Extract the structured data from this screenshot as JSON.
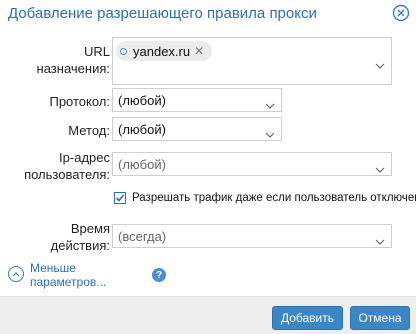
{
  "dialog": {
    "title": "Добавление разрешающего правила прокси"
  },
  "fields": {
    "url": {
      "label": "URL назначения:",
      "tags": [
        "yandex.ru"
      ]
    },
    "protocol": {
      "label": "Протокол:",
      "value": "(любой)"
    },
    "method": {
      "label": "Метод:",
      "value": "(любой)"
    },
    "user_ip": {
      "label": "Ip-адрес пользователя:",
      "placeholder": "(любой)"
    },
    "allow_when_disabled": {
      "label": "Разрешать трафик даже если пользователь отключен",
      "checked": true
    },
    "time": {
      "label": "Время действия:",
      "placeholder": "(всегда)"
    }
  },
  "less_params": {
    "label": "Меньше параметров..."
  },
  "help": {
    "glyph": "?"
  },
  "footer": {
    "add_label": "Добавить",
    "cancel_label": "Отмена"
  },
  "colors": {
    "accent": "#2b6fb6",
    "button": "#3b86c6",
    "footer_bg": "#eeeeee"
  },
  "icons": {
    "close": "close-circle-icon",
    "chevron": "chevron-down-icon",
    "less": "chevron-up-circle-icon",
    "help": "help-icon"
  }
}
